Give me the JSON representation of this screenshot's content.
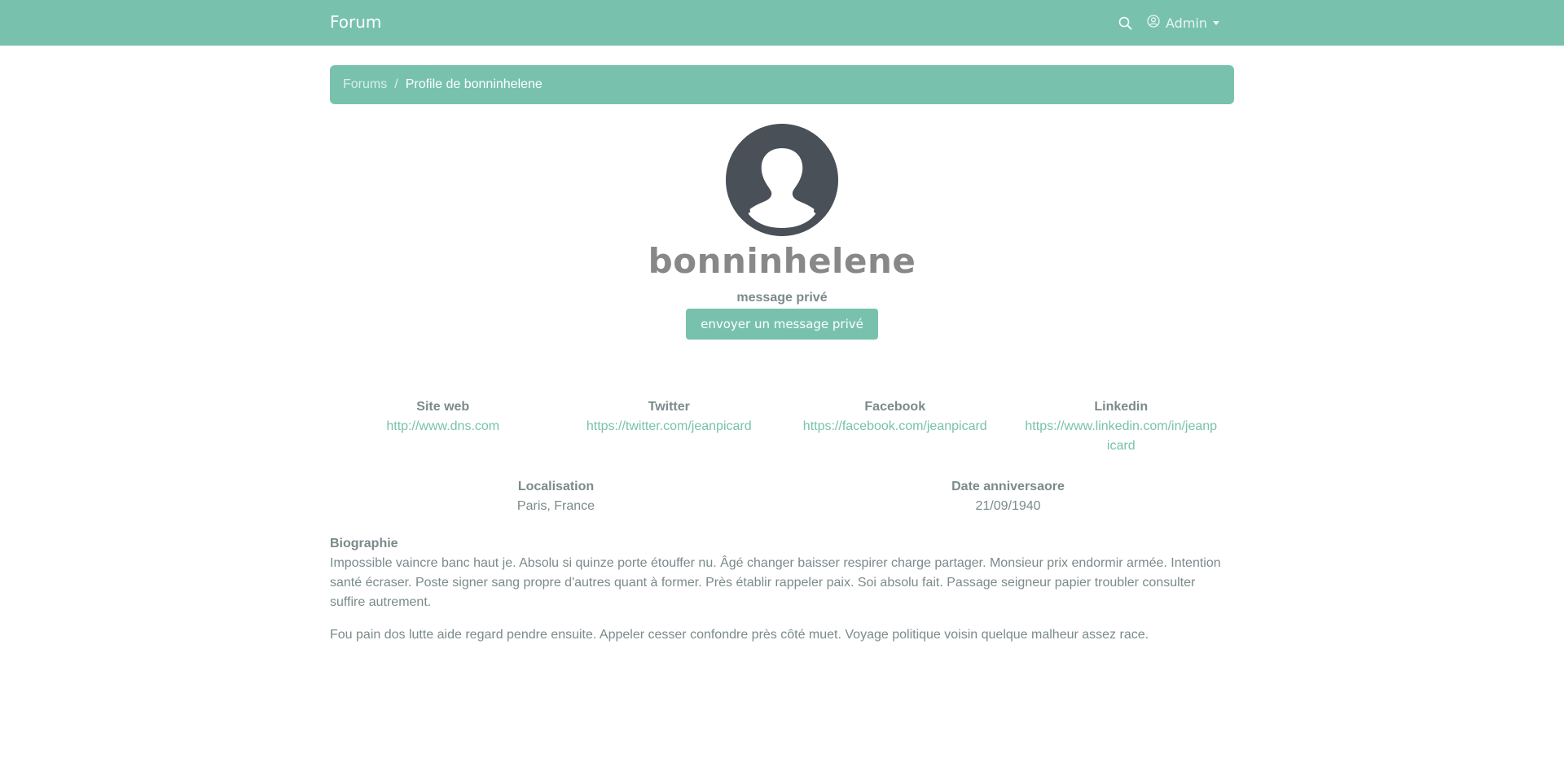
{
  "navbar": {
    "brand": "Forum",
    "user_label": "Admin"
  },
  "breadcrumb": {
    "root": "Forums",
    "separator": "/",
    "current": "Profile de bonninhelene"
  },
  "profile": {
    "username": "bonninhelene",
    "pm_label": "message privé",
    "pm_button": "envoyer un message privé"
  },
  "links": [
    {
      "label": "Site web",
      "value": "http://www.dns.com"
    },
    {
      "label": "Twitter",
      "value": "https://twitter.com/jeanpicard"
    },
    {
      "label": "Facebook",
      "value": "https://facebook.com/jeanpicard"
    },
    {
      "label": "Linkedin",
      "value": "https://www.linkedin.com/in/jeanpicard"
    }
  ],
  "details": [
    {
      "label": "Localisation",
      "value": "Paris, France"
    },
    {
      "label": "Date anniversaore",
      "value": "21/09/1940"
    }
  ],
  "bio": {
    "label": "Biographie",
    "paragraphs": [
      "Impossible vaincre banc haut je. Absolu si quinze porte étouffer nu. Âgé changer baisser respirer charge partager. Monsieur prix endormir armée. Intention santé écraser. Poste signer sang propre d'autres quant à former. Près établir rappeler paix. Soi absolu fait. Passage seigneur papier troubler consulter suffire autrement.",
      "Fou pain dos lutte aide regard pendre ensuite. Appeler cesser confondre près côté muet. Voyage politique voisin quelque malheur assez race."
    ]
  },
  "colors": {
    "primary": "#78c2ad",
    "text": "#7b8a8b",
    "avatar_bg": "#495057"
  },
  "icons": {
    "search": "search-icon",
    "user": "user-circle-icon",
    "avatar": "default-avatar-icon"
  }
}
